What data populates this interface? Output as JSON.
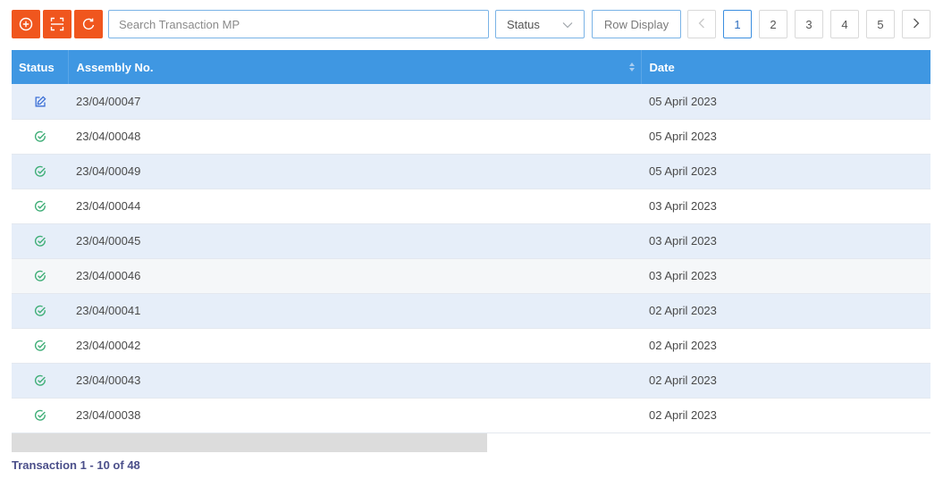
{
  "toolbar": {
    "add_icon": "plus-circle-icon",
    "scan_icon": "scan-icon",
    "refresh_icon": "refresh-icon",
    "search_placeholder": "Search Transaction MP",
    "status_label": "Status",
    "row_display_label": "Row Display"
  },
  "pagination": {
    "pages": [
      "1",
      "2",
      "3",
      "4",
      "5"
    ],
    "current": "1"
  },
  "table": {
    "headers": {
      "status": "Status",
      "assembly": "Assembly No.",
      "date": "Date"
    },
    "rows": [
      {
        "status": "edit",
        "assembly": "23/04/00047",
        "date": "05 April 2023"
      },
      {
        "status": "done",
        "assembly": "23/04/00048",
        "date": "05 April 2023"
      },
      {
        "status": "done",
        "assembly": "23/04/00049",
        "date": "05 April 2023"
      },
      {
        "status": "done",
        "assembly": "23/04/00044",
        "date": "03 April 2023"
      },
      {
        "status": "done",
        "assembly": "23/04/00045",
        "date": "03 April 2023"
      },
      {
        "status": "done",
        "assembly": "23/04/00046",
        "date": "03 April 2023"
      },
      {
        "status": "done",
        "assembly": "23/04/00041",
        "date": "02 April 2023"
      },
      {
        "status": "done",
        "assembly": "23/04/00042",
        "date": "02 April 2023"
      },
      {
        "status": "done",
        "assembly": "23/04/00043",
        "date": "02 April 2023"
      },
      {
        "status": "done",
        "assembly": "23/04/00038",
        "date": "02 April 2023"
      }
    ]
  },
  "footer": {
    "count_text": "Transaction 1 - 10 of 48"
  },
  "colors": {
    "accent_orange": "#f0561e",
    "header_blue": "#3f97e2",
    "row_stripe": "#e6eef9",
    "done_green": "#3fae77",
    "edit_blue": "#3b6fd6"
  }
}
